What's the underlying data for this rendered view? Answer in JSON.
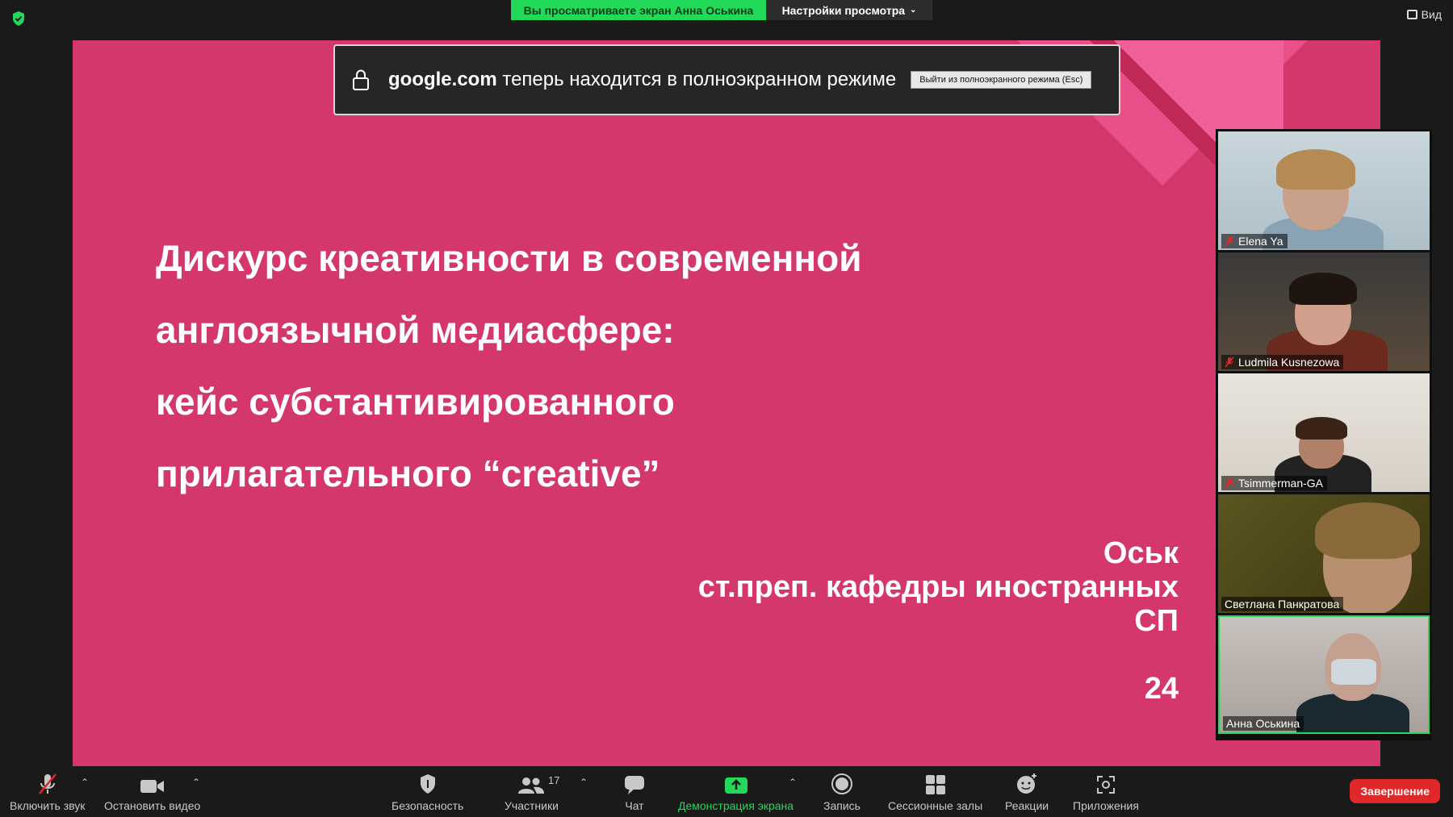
{
  "top_bar": {
    "share_banner": "Вы просматриваете экран Анна Оськина",
    "view_options": "Настройки просмотра",
    "view_button": "Вид"
  },
  "fullscreen_notice": {
    "domain": "google.com",
    "message": "теперь находится в полноэкранном режиме",
    "exit_button": "Выйти из полноэкранного режима (Esc)"
  },
  "slide": {
    "title_lines": [
      "Дискурс креативности в современной",
      "англоязычной медиасфере:",
      "кейс субстантивированного",
      "прилагательного “creative”"
    ],
    "right_lines": [
      "Оськ",
      "ст.преп. кафедры иностранных",
      "СП",
      "",
      "24"
    ]
  },
  "participants": [
    {
      "name": "Elena Ya",
      "muted": true
    },
    {
      "name": "Ludmila Kusnezowa",
      "muted": true
    },
    {
      "name": "Tsimmerman-GA",
      "muted": true
    },
    {
      "name": "Светлана Панкратова",
      "muted": false
    },
    {
      "name": "Анна Оськина",
      "muted": false,
      "active": true
    }
  ],
  "toolbar": {
    "unmute": "Включить звук",
    "stop_video": "Остановить видео",
    "security": "Безопасность",
    "participants": "Участники",
    "participants_count": "17",
    "chat": "Чат",
    "share_screen": "Демонстрация экрана",
    "record": "Запись",
    "breakout_rooms": "Сессионные залы",
    "reactions": "Реакции",
    "apps": "Приложения",
    "end": "Завершение"
  },
  "colors": {
    "slide_bg": "#d4376a",
    "accent_green": "#23d959",
    "end_red": "#e02828"
  }
}
